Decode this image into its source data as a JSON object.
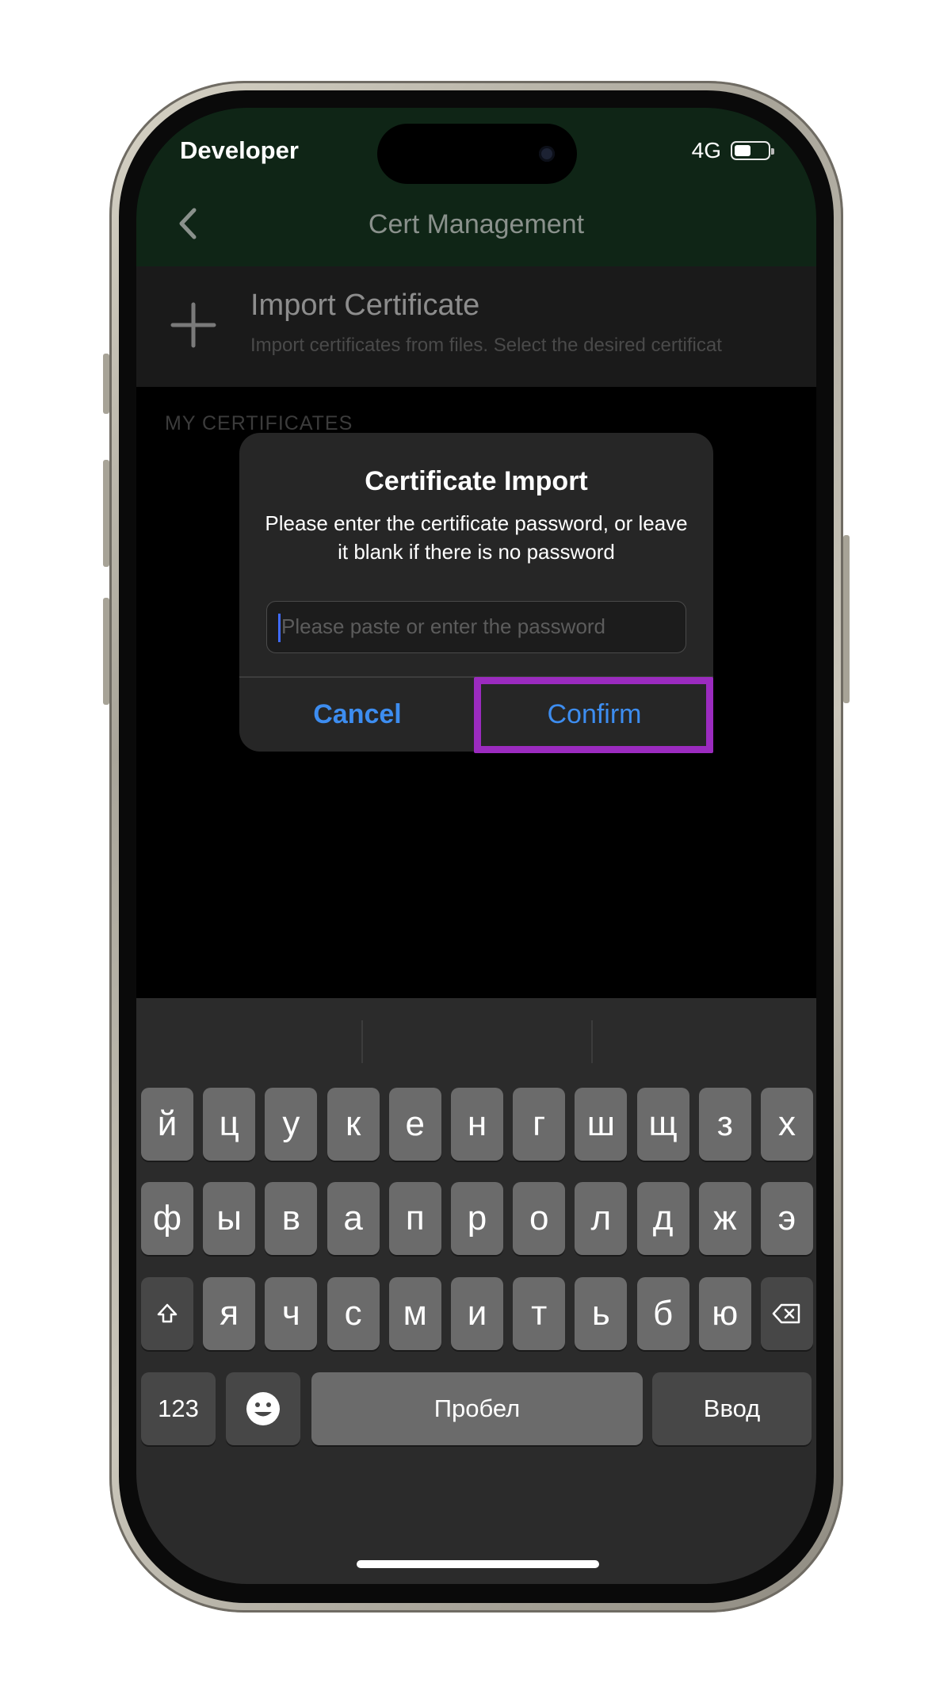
{
  "status_bar": {
    "carrier": "Developer",
    "network": "4G"
  },
  "nav": {
    "title": "Cert Management"
  },
  "import_row": {
    "title": "Import Certificate",
    "subtitle": "Import certificates from files. Select the desired certificat"
  },
  "section_label": "MY CERTIFICATES",
  "alert": {
    "title": "Certificate Import",
    "message": "Please enter the certificate password, or leave it blank if there is no password",
    "input_placeholder": "Please paste or enter the password",
    "input_value": "",
    "cancel_label": "Cancel",
    "confirm_label": "Confirm"
  },
  "keyboard": {
    "row1": [
      "й",
      "ц",
      "у",
      "к",
      "е",
      "н",
      "г",
      "ш",
      "щ",
      "з",
      "х"
    ],
    "row2": [
      "ф",
      "ы",
      "в",
      "а",
      "п",
      "р",
      "о",
      "л",
      "д",
      "ж",
      "э"
    ],
    "row3": [
      "я",
      "ч",
      "с",
      "м",
      "и",
      "т",
      "ь",
      "б",
      "ю"
    ],
    "numbers_label": "123",
    "space_label": "Пробел",
    "return_label": "Ввод"
  },
  "colors": {
    "accent": "#3d8df0",
    "highlight": "#9b2bbf",
    "nav_background": "#0f2516"
  }
}
